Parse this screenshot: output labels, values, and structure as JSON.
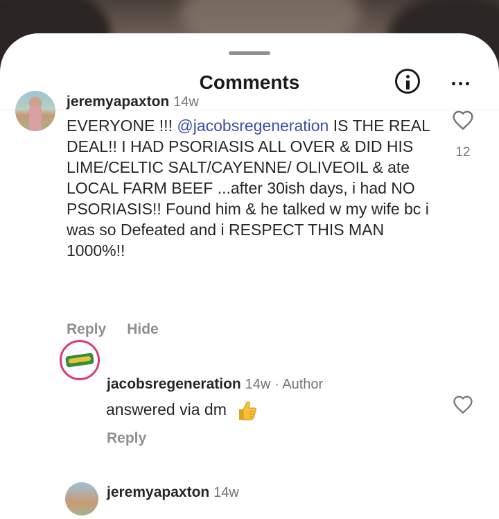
{
  "header": {
    "title": "Comments"
  },
  "comments": [
    {
      "username": "jeremyapaxton",
      "time": "14w",
      "text_before": "EVERYONE !!! ",
      "mention": "@jacobsregeneration",
      "text_after": " IS THE REAL DEAL!! I HAD PSORIASIS ALL OVER & DID HIS LIME/CELTIC SALT/CAYENNE/ OLIVEOIL & ate LOCAL FARM  BEEF ...after 30ish days, i had NO PSORIASIS!! Found him & he talked w my wife bc i was so Defeated and i RESPECT THIS MAN 1000%!!",
      "likes": "12",
      "reply_label": "Reply",
      "hide_label": "Hide"
    },
    {
      "username": "jacobsregeneration",
      "time": "14w",
      "author_label": "· Author",
      "text": "answered via dm",
      "reply_label": "Reply"
    },
    {
      "username": "jeremyapaxton",
      "time": "14w"
    }
  ],
  "colors": {
    "mention": "#3a4fa8",
    "avatar_ring": "#d93a7a"
  },
  "icons": {
    "info": "info-icon",
    "more": "more-horizontal-icon",
    "like": "heart-outline-icon",
    "emoji": "thumbs-up-emoji"
  }
}
